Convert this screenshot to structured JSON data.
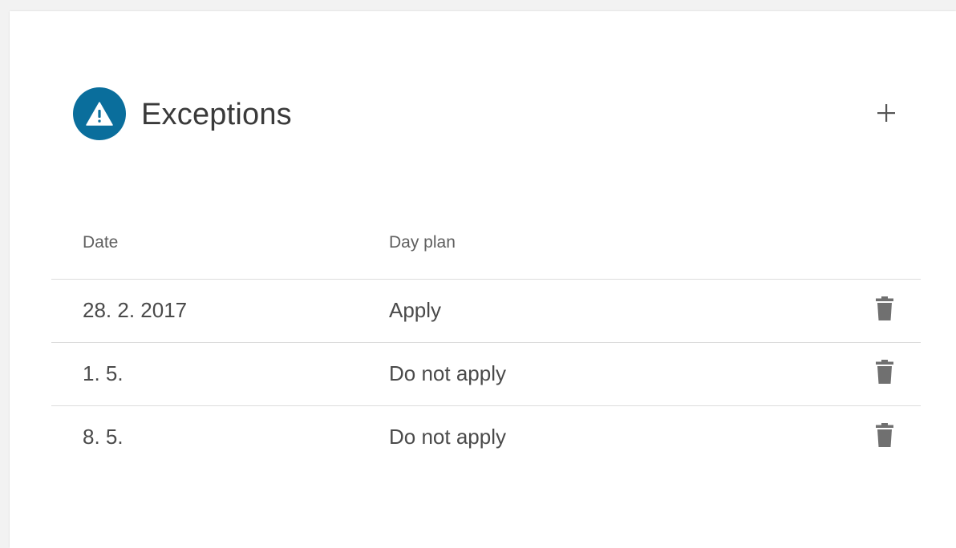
{
  "header": {
    "title": "Exceptions",
    "icon": "warning-icon",
    "icon_bg_color": "#0a6e9c",
    "add_icon": "plus-icon"
  },
  "table": {
    "columns": [
      "Date",
      "Day plan"
    ],
    "rows": [
      {
        "date": "28. 2. 2017",
        "day_plan": "Apply",
        "action_icon": "trash-icon"
      },
      {
        "date": "1. 5.",
        "day_plan": "Do not apply",
        "action_icon": "trash-icon"
      },
      {
        "date": "8. 5.",
        "day_plan": "Do not apply",
        "action_icon": "trash-icon"
      }
    ]
  },
  "colors": {
    "accent": "#0a6e9c",
    "icon_gray": "#707070",
    "divider": "#dcdcdc"
  }
}
